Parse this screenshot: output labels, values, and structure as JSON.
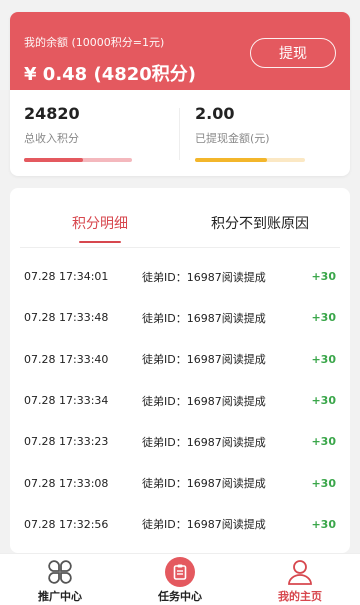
{
  "balance": {
    "label": "我的余额 (10000积分=1元)",
    "value": "¥ 0.48 (4820积分)",
    "withdraw_label": "提现",
    "accent_color": "#e4595f"
  },
  "stats": [
    {
      "value": "24820",
      "caption": "总收入积分",
      "bar_fill": 0.55,
      "bar_color": "#e4595f"
    },
    {
      "value": "2.00",
      "caption": "已提现金额(元)",
      "bar_fill": 0.65,
      "bar_color": "#f3b62b"
    }
  ],
  "tabs": [
    {
      "label": "积分明细",
      "active": true
    },
    {
      "label": "积分不到账原因",
      "active": false
    }
  ],
  "records": [
    {
      "time": "07.28 17:34:01",
      "desc": "徒弟ID：16987阅读提成",
      "points": "+30"
    },
    {
      "time": "07.28 17:33:48",
      "desc": "徒弟ID：16987阅读提成",
      "points": "+30"
    },
    {
      "time": "07.28 17:33:40",
      "desc": "徒弟ID：16987阅读提成",
      "points": "+30"
    },
    {
      "time": "07.28 17:33:34",
      "desc": "徒弟ID：16987阅读提成",
      "points": "+30"
    },
    {
      "time": "07.28 17:33:23",
      "desc": "徒弟ID：16987阅读提成",
      "points": "+30"
    },
    {
      "time": "07.28 17:33:08",
      "desc": "徒弟ID：16987阅读提成",
      "points": "+30"
    },
    {
      "time": "07.28 17:32:56",
      "desc": "徒弟ID：16987阅读提成",
      "points": "+30"
    }
  ],
  "nav": [
    {
      "label": "推广中心",
      "icon": "clover-grid-icon",
      "active": false
    },
    {
      "label": "任务中心",
      "icon": "clipboard-icon",
      "active": false
    },
    {
      "label": "我的主页",
      "icon": "user-icon",
      "active": true
    }
  ]
}
